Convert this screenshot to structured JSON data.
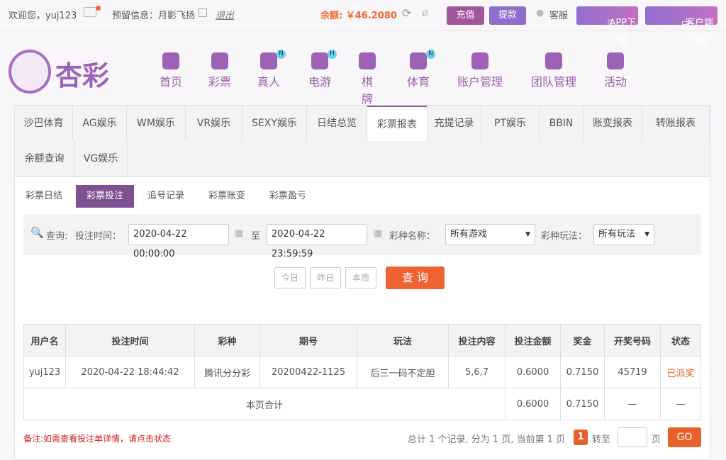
{
  "topbar": {
    "welcome": "欢迎您，yuj123",
    "reserved": "预留信息：月影飞扬",
    "logout": "退出",
    "balance": "余额: ￥46.2080",
    "deposit": "充值",
    "withdraw": "提款",
    "service": "客服",
    "app": "APP下载",
    "client": "客户端下载"
  },
  "logo": "杏彩",
  "nav": [
    {
      "label": "首页"
    },
    {
      "label": "彩票"
    },
    {
      "label": "真人",
      "badge": "N"
    },
    {
      "label": "电游",
      "badge": "H"
    },
    {
      "label": "棋牌"
    },
    {
      "label": "体育",
      "badge": "N"
    },
    {
      "label": "账户管理"
    },
    {
      "label": "团队管理"
    },
    {
      "label": "活动"
    }
  ],
  "tabs": [
    "沙巴体育",
    "AG娱乐",
    "WM娱乐",
    "VR娱乐",
    "SEXY娱乐",
    "日结总览",
    "彩票报表",
    "充提记录",
    "PT娱乐",
    "BBIN",
    "账变报表",
    "转账报表",
    "余额查询",
    "VG娱乐"
  ],
  "subtabs": [
    "彩票日结",
    "彩票投注",
    "追号记录",
    "彩票账变",
    "彩票盈亏"
  ],
  "filter": {
    "query": "查询:",
    "time_label": "投注时间：",
    "start": "2020-04-22 00:00:00",
    "to": "至",
    "end": "2020-04-22 23:59:59",
    "game_label": "彩种名称：",
    "game": "所有游戏",
    "play_label": "彩种玩法：",
    "play": "所有玩法",
    "today": "今日",
    "yesterday": "昨日",
    "week": "本周",
    "search": "查 询"
  },
  "table": {
    "headers": [
      "用户名",
      "投注时间",
      "彩种",
      "期号",
      "玩法",
      "投注内容",
      "投注金额",
      "奖金",
      "开奖号码",
      "状态"
    ],
    "rows": [
      [
        "yuj123",
        "2020-04-22 18:44:42",
        "腾讯分分彩",
        "20200422-1125",
        "后三一码不定胆",
        "5,6,7",
        "0.6000",
        "0.7150",
        "45719",
        "已派奖"
      ]
    ],
    "total": {
      "label": "本页合计",
      "amount": "0.6000",
      "prize": "0.7150",
      "dash1": "—",
      "dash2": "—"
    }
  },
  "footer": {
    "note": "备注:如需查看投注单详情，请点击状态",
    "summary": "总计 1 个记录, 分为 1 页, 当前第 1 页",
    "page": "1",
    "goto": "转至",
    "page_unit": "页",
    "go": "GO"
  },
  "colors": {
    "accent": "#8b5aa0",
    "orange": "#e8612c",
    "status": "#e8612c"
  }
}
